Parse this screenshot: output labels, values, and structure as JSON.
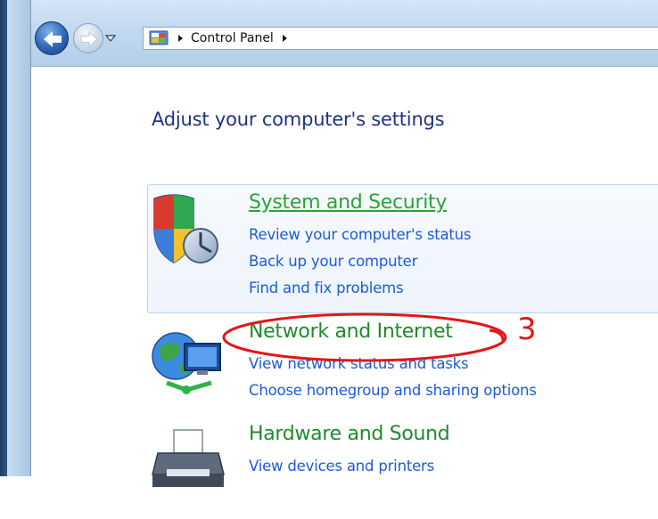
{
  "address_bar": {
    "breadcrumb": "Control Panel"
  },
  "page": {
    "title": "Adjust your computer's settings"
  },
  "categories": [
    {
      "title": "System and Security",
      "links": [
        "Review your computer's status",
        "Back up your computer",
        "Find and fix problems"
      ]
    },
    {
      "title": "Network and Internet",
      "links": [
        "View network status and tasks",
        "Choose homegroup and sharing options"
      ]
    },
    {
      "title": "Hardware and Sound",
      "links": [
        "View devices and printers"
      ]
    }
  ],
  "annotation": {
    "number": "3"
  },
  "colors": {
    "category_title": "#1f8b2a",
    "link": "#1d5bd6",
    "page_title": "#1e3287",
    "annotation": "#e01818"
  },
  "icons": [
    "back-arrow-icon",
    "forward-arrow-icon",
    "history-dropdown-icon",
    "control-panel-icon",
    "breadcrumb-chevron-icon",
    "shield-icon",
    "network-globe-icon",
    "printer-icon"
  ]
}
